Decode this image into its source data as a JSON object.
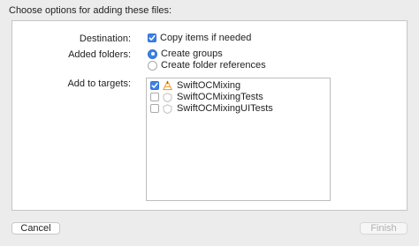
{
  "dialog": {
    "heading": "Choose options for adding these files:"
  },
  "destination": {
    "label": "Destination:",
    "copy_items": {
      "label": "Copy items if needed",
      "checked": true
    }
  },
  "added_folders": {
    "label": "Added folders:",
    "options": [
      {
        "label": "Create groups",
        "selected": true
      },
      {
        "label": "Create folder references",
        "selected": false
      }
    ]
  },
  "add_to_targets": {
    "label": "Add to targets:",
    "targets": [
      {
        "label": "SwiftOCMixing",
        "checked": true,
        "icon": "app-target-icon"
      },
      {
        "label": "SwiftOCMixingTests",
        "checked": false,
        "icon": "test-bundle-icon"
      },
      {
        "label": "SwiftOCMixingUITests",
        "checked": false,
        "icon": "test-bundle-icon"
      }
    ]
  },
  "buttons": {
    "cancel": "Cancel",
    "finish": "Finish",
    "finish_enabled": false
  },
  "colors": {
    "accent": "#3b82e6",
    "window_bg": "#ececec",
    "panel_bg": "#ffffff"
  }
}
